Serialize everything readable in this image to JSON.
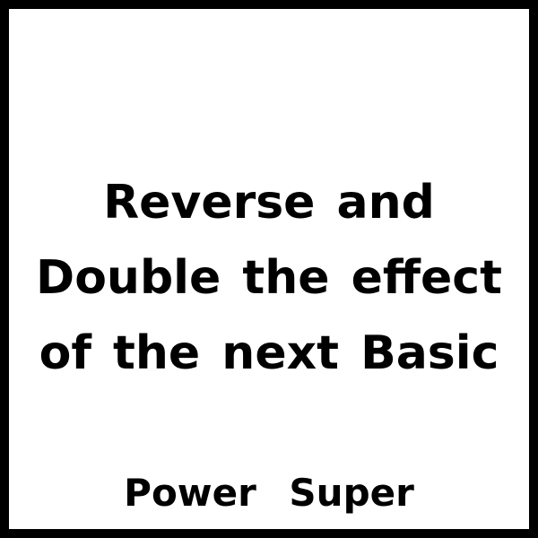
{
  "card": {
    "effect_lines": [
      "Reverse and",
      "Double the effect",
      "of the next Basic"
    ],
    "type_tags": [
      "Power",
      "Super"
    ]
  },
  "colors": {
    "border": "#000000",
    "background": "#ffffff",
    "text": "#000000"
  }
}
